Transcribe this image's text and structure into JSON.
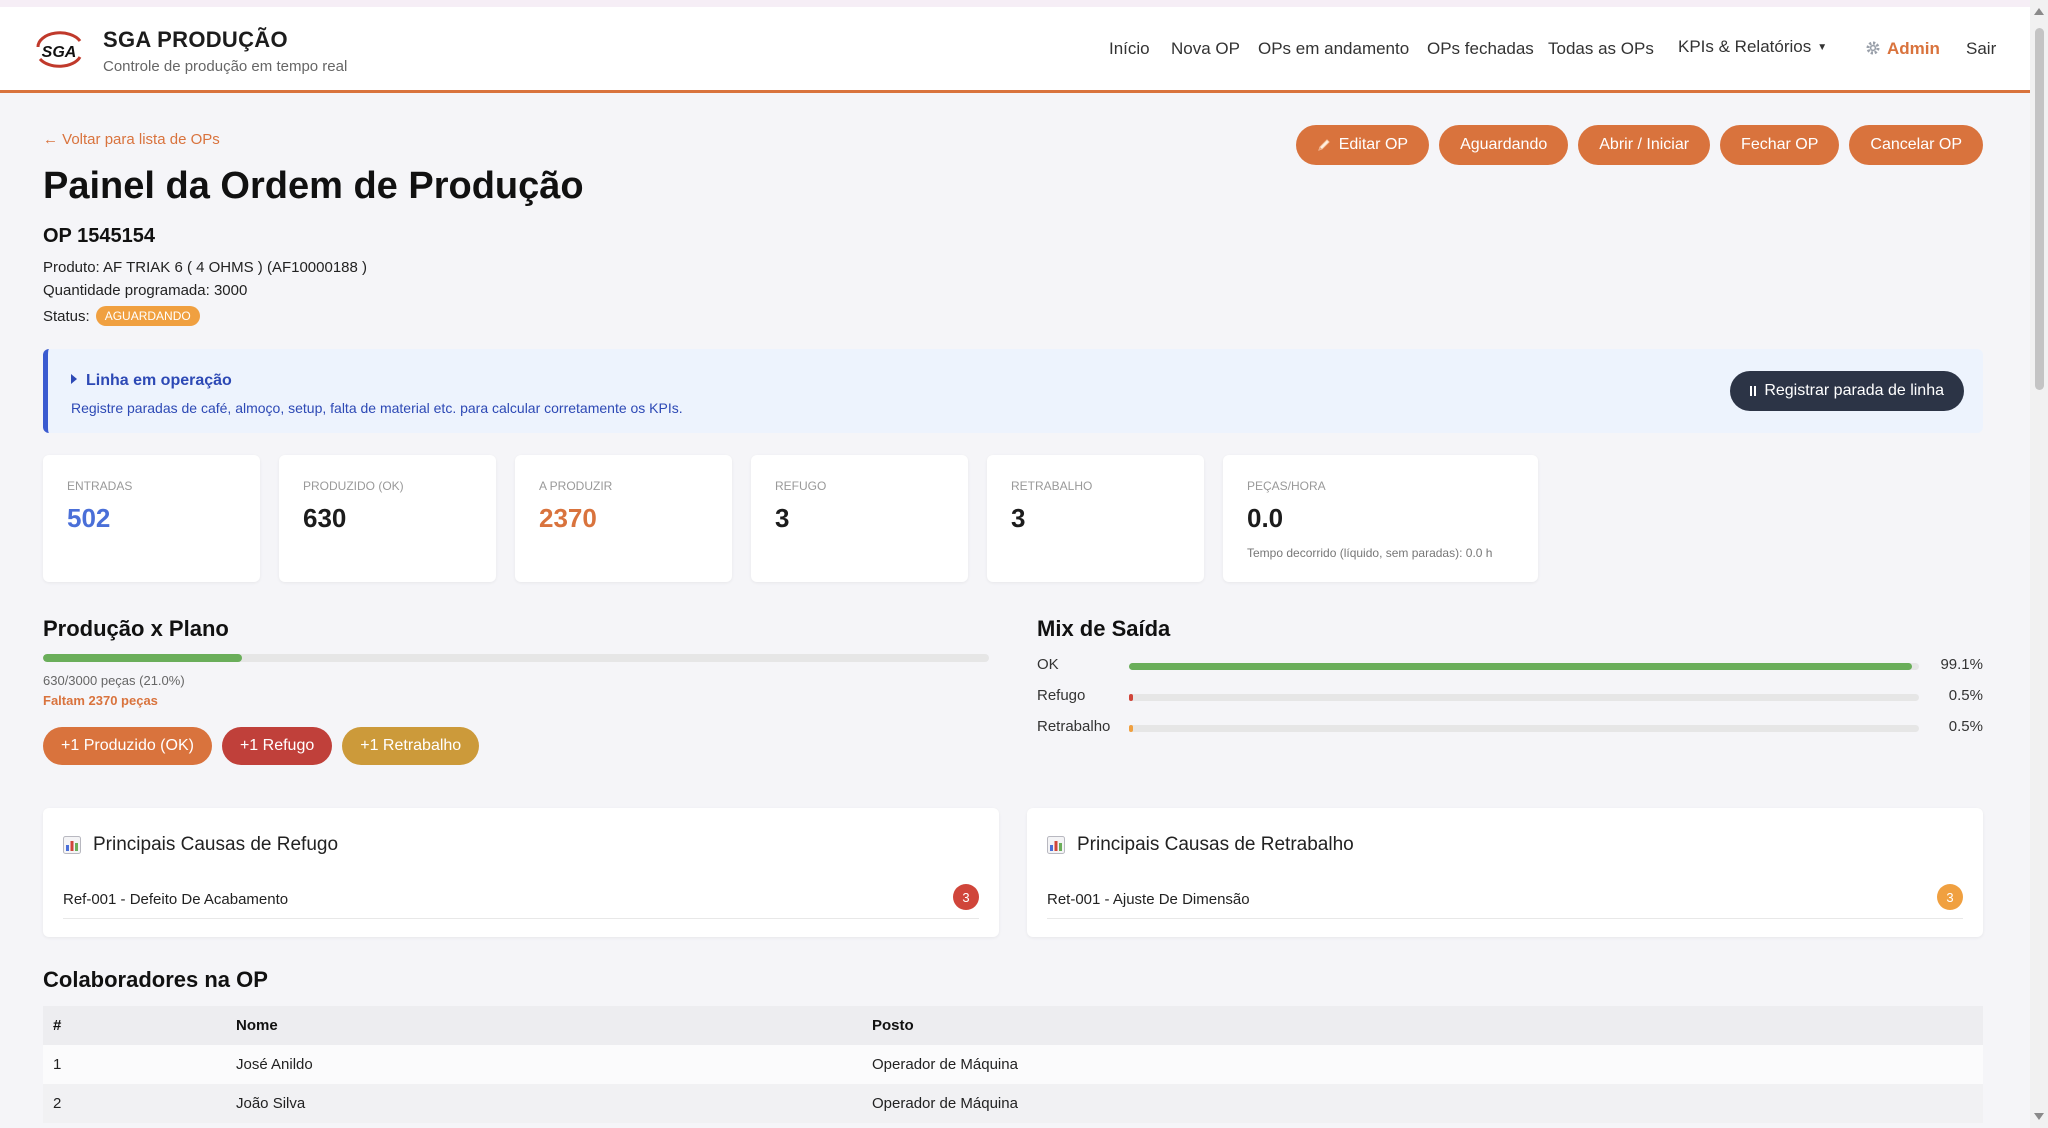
{
  "header": {
    "brand_title": "SGA PRODUÇÃO",
    "brand_subtitle": "Controle de produção em tempo real",
    "logo_text": "SGA",
    "nav": {
      "inicio": "Início",
      "nova_op": "Nova OP",
      "ops_andamento": "OPs em andamento",
      "ops_fechadas": "OPs fechadas",
      "todas_ops": "Todas as OPs",
      "kpis": "KPIs & Relatórios",
      "admin": "Admin",
      "sair": "Sair"
    }
  },
  "back_link": "← Voltar para lista de OPs",
  "actions": {
    "editar": "Editar OP",
    "aguardando": "Aguardando",
    "abrir": "Abrir / Iniciar",
    "fechar": "Fechar OP",
    "cancelar": "Cancelar OP"
  },
  "page_title": "Painel da Ordem de Produção",
  "op": {
    "number": "OP 1545154",
    "product": "Produto: AF TRIAK 6 ( 4 OHMS ) (AF10000188 )",
    "quantity": "Quantidade programada: 3000",
    "status_label": "Status:",
    "status_value": "AGUARDANDO"
  },
  "line_panel": {
    "title": "Linha em operação",
    "description": "Registre paradas de café, almoço, setup, falta de material etc. para calcular corretamente os KPIs.",
    "button": "Registrar parada de linha"
  },
  "kpis": {
    "entradas": {
      "label": "Entradas",
      "value": "502"
    },
    "produzido": {
      "label": "Produzido (OK)",
      "value": "630"
    },
    "a_produzir": {
      "label": "A produzir",
      "value": "2370"
    },
    "refugo": {
      "label": "Refugo",
      "value": "3"
    },
    "retrabalho": {
      "label": "Retrabalho",
      "value": "3"
    },
    "pecas_hora": {
      "label": "Peças/hora",
      "value": "0.0",
      "note": "Tempo decorrido (líquido, sem paradas): 0.0 h"
    }
  },
  "production": {
    "title": "Produção x Plano",
    "progress_fraction": 0.21,
    "progress_text": "630/3000 peças (21.0%)",
    "remaining_text": "Faltam 2370 peças",
    "buttons": {
      "ok": "+1 Produzido (OK)",
      "refugo": "+1 Refugo",
      "retrabalho": "+1 Retrabalho"
    }
  },
  "mix": {
    "title": "Mix de Saída",
    "items": [
      {
        "label": "OK",
        "value": 99.1,
        "pct": "99.1%",
        "color": "#6aae5a"
      },
      {
        "label": "Refugo",
        "value": 0.5,
        "pct": "0.5%",
        "color": "#d0453a"
      },
      {
        "label": "Retrabalho",
        "value": 0.5,
        "pct": "0.5%",
        "color": "#f0a040"
      }
    ]
  },
  "causes": {
    "refugo": {
      "title": "Principais Causas de Refugo",
      "item": "Ref-001 - Defeito De Acabamento",
      "count": "3",
      "color": "#d0453a"
    },
    "retrabalho": {
      "title": "Principais Causas de Retrabalho",
      "item": "Ret-001 - Ajuste De Dimensão",
      "count": "3",
      "color": "#f0a040"
    }
  },
  "collaborators": {
    "title": "Colaboradores na OP",
    "headers": {
      "num": "#",
      "nome": "Nome",
      "posto": "Posto"
    },
    "rows": [
      {
        "num": "1",
        "nome": "José Anildo",
        "posto": "Operador de Máquina"
      },
      {
        "num": "2",
        "nome": "João Silva",
        "posto": "Operador de Máquina"
      }
    ]
  },
  "colors": {
    "accent": "#d9733d",
    "blue_value": "#4a6fd8",
    "orange_value": "#d9733d",
    "refugo_btn": "#c0403a",
    "retrabalho_btn": "#cc9a3a",
    "dark_btn": "#2c3446"
  }
}
